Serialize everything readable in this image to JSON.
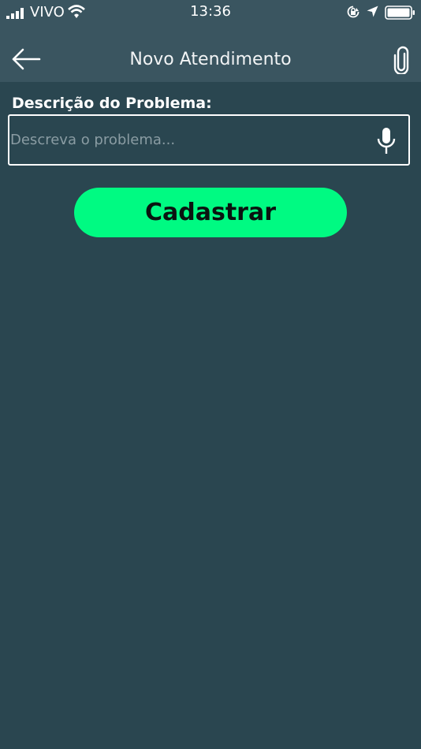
{
  "status_bar": {
    "carrier": "VIVO",
    "time": "13:36",
    "icons": [
      "signal-icon",
      "wifi-icon",
      "rotation-lock-icon",
      "location-arrow-icon",
      "battery-icon"
    ]
  },
  "header": {
    "title": "Novo Atendimento",
    "back_icon": "arrow-left-icon",
    "attach_icon": "paperclip-icon"
  },
  "form": {
    "label": "Descrição do Problema:",
    "placeholder": "Descreva o problema...",
    "value": "",
    "mic_icon": "microphone-icon",
    "submit_label": "Cadastrar"
  },
  "colors": {
    "background": "#2a4650",
    "header": "#3a5560",
    "accent": "#00fa82"
  }
}
